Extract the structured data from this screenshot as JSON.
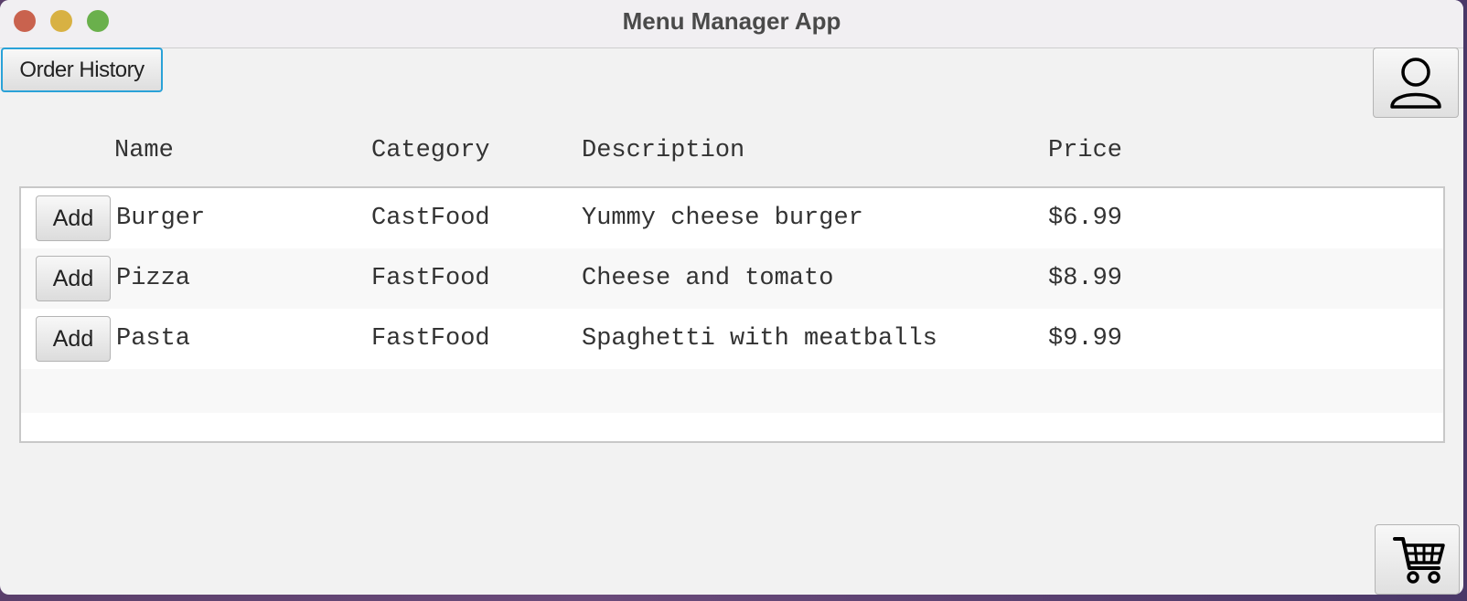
{
  "window": {
    "title": "Menu Manager App"
  },
  "toolbar": {
    "order_history_label": "Order History",
    "profile_icon": "user-icon",
    "cart_icon": "shopping-cart-icon"
  },
  "table": {
    "columns": [
      "Name",
      "Category",
      "Description",
      "Price"
    ],
    "rows": [
      {
        "action": "Add",
        "name": "Burger",
        "category": "CastFood",
        "description": "Yummy cheese burger",
        "price": "$6.99"
      },
      {
        "action": "Add",
        "name": "Pizza",
        "category": "FastFood",
        "description": "Cheese and tomato",
        "price": "$8.99"
      },
      {
        "action": "Add",
        "name": "Pasta",
        "category": "FastFood",
        "description": "Spaghetti with meatballs",
        "price": "$9.99"
      }
    ]
  },
  "colors": {
    "focus_accent": "#2aa2d8",
    "close": "#c9624e",
    "minimize": "#d8b143",
    "maximize": "#6ab04c"
  }
}
